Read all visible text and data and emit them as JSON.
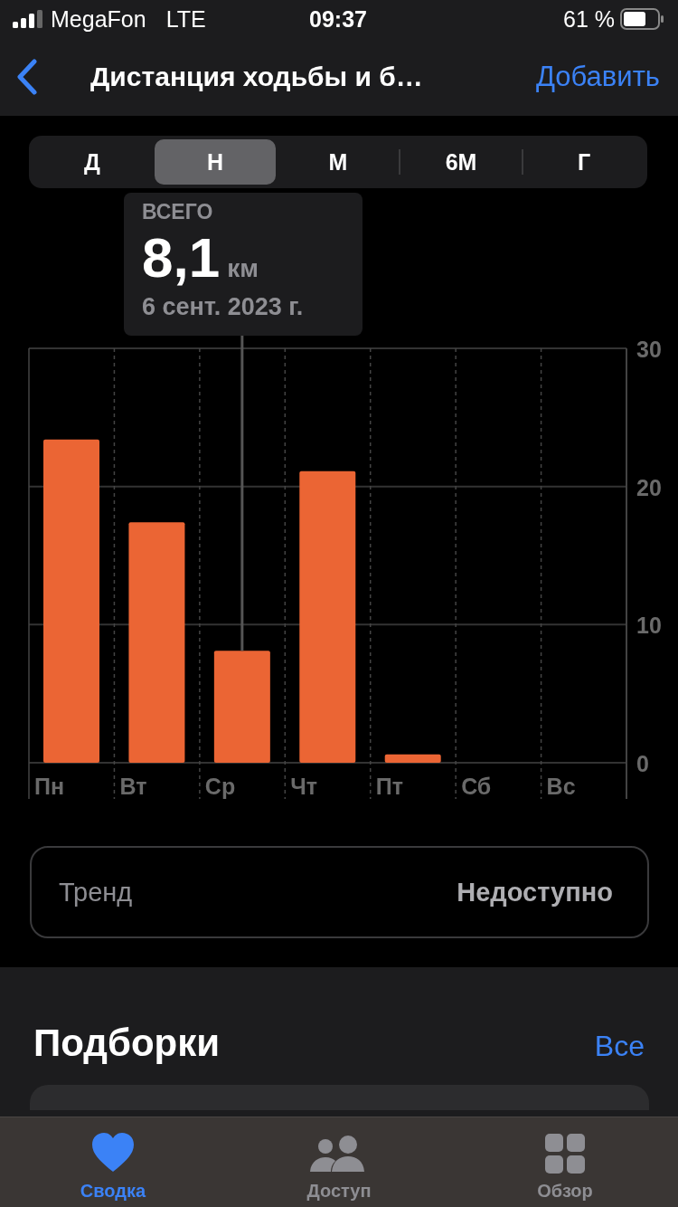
{
  "status_bar": {
    "carrier": "MegaFon",
    "network": "LTE",
    "time": "09:37",
    "battery": "61 %"
  },
  "nav": {
    "title": "Дистанция ходьбы и б…",
    "action": "Добавить"
  },
  "segments": [
    {
      "label": "Д",
      "selected": false
    },
    {
      "label": "Н",
      "selected": true
    },
    {
      "label": "М",
      "selected": false
    },
    {
      "label": "6М",
      "selected": false
    },
    {
      "label": "Г",
      "selected": false
    }
  ],
  "chart": {
    "chart_data": {
      "type": "bar",
      "categories": [
        "Пн",
        "Вт",
        "Ср",
        "Чт",
        "Пт",
        "Сб",
        "Вс"
      ],
      "series": [
        {
          "color": "#eb6534",
          "values": [
            23.4,
            17.4,
            8.1,
            21.1,
            0.6,
            null,
            null
          ]
        }
      ],
      "ylim": [
        0,
        30
      ],
      "yticks": [
        0,
        10,
        20,
        30
      ]
    },
    "tooltip": {
      "label": "ВСЕГО",
      "value": "8,1",
      "unit": "км",
      "date": "6 сент. 2023 г."
    }
  },
  "trend": {
    "label": "Тренд",
    "value": "Недоступно"
  },
  "highlights": {
    "title": "Подборки",
    "link": "Все"
  },
  "tab_bar": [
    {
      "label": "Сводка",
      "kind": "heart",
      "selected": true
    },
    {
      "label": "Доступ",
      "kind": "people",
      "selected": false
    },
    {
      "label": "Обзор",
      "kind": "grid",
      "selected": false
    }
  ]
}
